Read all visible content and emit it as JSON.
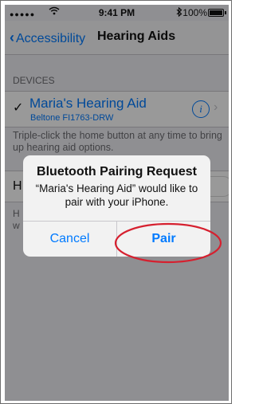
{
  "status_bar": {
    "signal": "●●●●●",
    "wifi_icon": "wifi-icon",
    "time": "9:41 PM",
    "bluetooth_icon": "bluetooth-icon",
    "battery_percent": "100%",
    "battery_level": 1.0
  },
  "nav": {
    "back_label": "Accessibility",
    "title": "Hearing Aids"
  },
  "devices": {
    "header": "DEVICES",
    "aid_name": "Maria's Hearing Aid",
    "aid_model": "Beltone FI1763-DRW",
    "footer": "Triple-click the home button at any time to bring up hearing aid options."
  },
  "partially_obscured": {
    "row_letter": "H",
    "footer_letters": "H\nw"
  },
  "alert": {
    "title": "Bluetooth Pairing Request",
    "message": "“Maria's Hearing Aid” would like to pair with your iPhone.",
    "cancel_label": "Cancel",
    "pair_label": "Pair",
    "highlight_color": "#d6202f"
  },
  "colors": {
    "accent": "#007aff",
    "background": "#efeff4"
  }
}
